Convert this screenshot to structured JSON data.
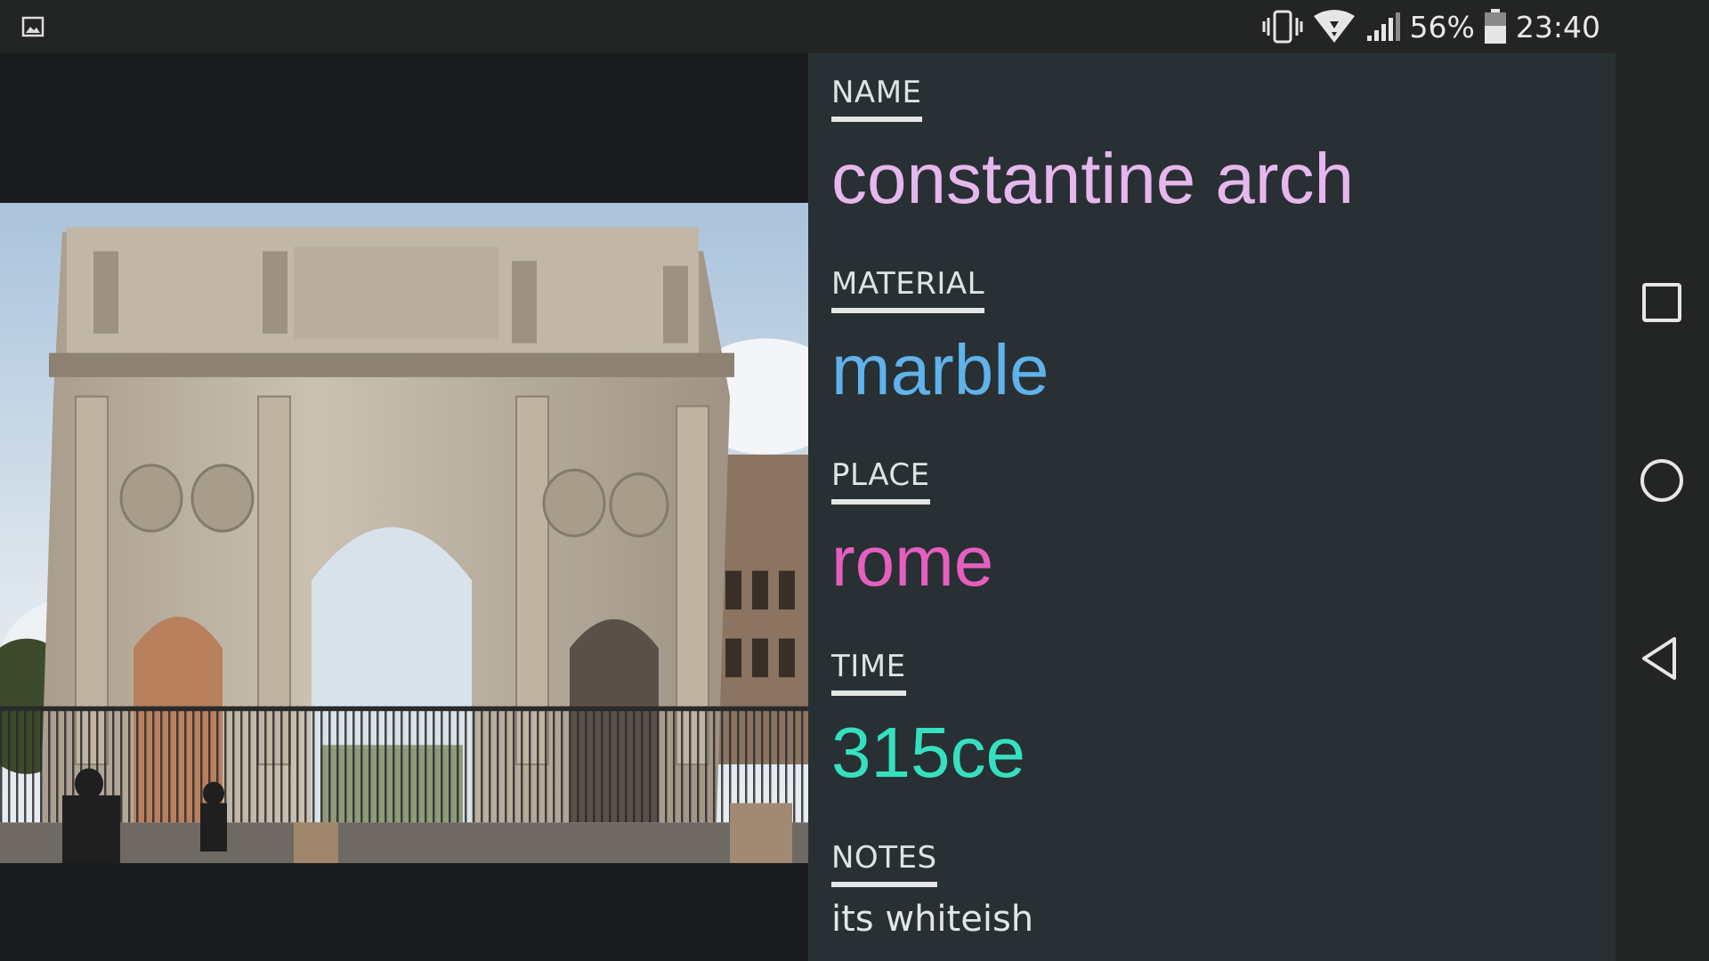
{
  "status_bar": {
    "left_icon": "image-icon",
    "battery_percent": "56%",
    "time": "23:40",
    "icons": [
      "vibrate-icon",
      "wifi-icon",
      "signal-icon",
      "battery-icon"
    ]
  },
  "photo": {
    "subject": "arch-photo"
  },
  "fields": [
    {
      "label": "NAME",
      "value": "constantine arch",
      "color": "#e6b7ef"
    },
    {
      "label": "MATERIAL",
      "value": "marble",
      "color": "#5fb2ea"
    },
    {
      "label": "PLACE",
      "value": "rome",
      "color": "#e65fc0"
    },
    {
      "label": "TIME",
      "value": "315ce",
      "color": "#35e0c0"
    }
  ],
  "notes": {
    "label": "NOTES",
    "value": "its whiteish"
  },
  "navbar": {
    "buttons": [
      "recents-icon",
      "home-icon",
      "back-icon"
    ]
  }
}
